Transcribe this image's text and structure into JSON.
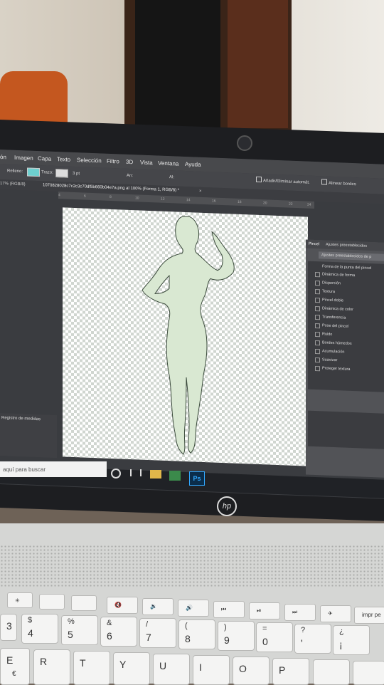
{
  "menu": [
    "ón",
    "Imagen",
    "Capa",
    "Texto",
    "Selección",
    "Filtro",
    "3D",
    "Vista",
    "Ventana",
    "Ayuda"
  ],
  "options": {
    "relleno": "Relleno:",
    "trazo": "Trazo:",
    "stroke_size": "3 pt",
    "an": "An:",
    "al": "Al:",
    "auto_add": "Añadir/Eliminar automát.",
    "align_edges": "Alinear bordes"
  },
  "document_tab": "1070828028c7c2c3c70df5b660b04e7a.png al 100% (Forma 1, RGB/8) *",
  "zoom_info": "17% (RGB/8)",
  "ruler_ticks": [
    "4",
    "6",
    "8",
    "10",
    "12",
    "14",
    "16",
    "18",
    "20",
    "22",
    "24"
  ],
  "panel": {
    "tab_active": "Pincel",
    "tab_other": "Ajustes preestablecidos",
    "preset_button": "Ajustes preestablecidos de p",
    "items": [
      "Forma de la punta del pincel",
      "Dinámica de forma",
      "Dispersión",
      "Textura",
      "Pincel doble",
      "Dinámica de color",
      "Transferencia",
      "Pose del pincel",
      "Ruido",
      "Bordes húmedos",
      "Acumulación",
      "Suavizar",
      "Proteger textura"
    ]
  },
  "history_panel": {
    "title": "Registro de medidas"
  },
  "taskbar": {
    "search_placeholder": "aquí para buscar",
    "ps_label": "Ps"
  },
  "laptop": {
    "logo": "hp"
  },
  "keyboard": {
    "num_row": [
      {
        "main": "3",
        "top": "·"
      },
      {
        "main": "4",
        "top": "$"
      },
      {
        "main": "5",
        "top": "%"
      },
      {
        "main": "6",
        "top": "&"
      },
      {
        "main": "7",
        "top": "/"
      },
      {
        "main": "8",
        "top": "("
      },
      {
        "main": "9",
        "top": ")"
      },
      {
        "main": "0",
        "top": "="
      },
      {
        "main": "'",
        "top": "?"
      },
      {
        "main": "¡",
        "top": "¿"
      }
    ],
    "letter_row": [
      "E",
      "R",
      "T",
      "Y",
      "U",
      "I",
      "O",
      "P"
    ],
    "impr_pe": "impr pe",
    "euro": "€"
  },
  "colors": {
    "figure_fill": "#d9e8d2",
    "ps_icon": "#0b2d4a",
    "ps_text": "#31a8ff"
  }
}
